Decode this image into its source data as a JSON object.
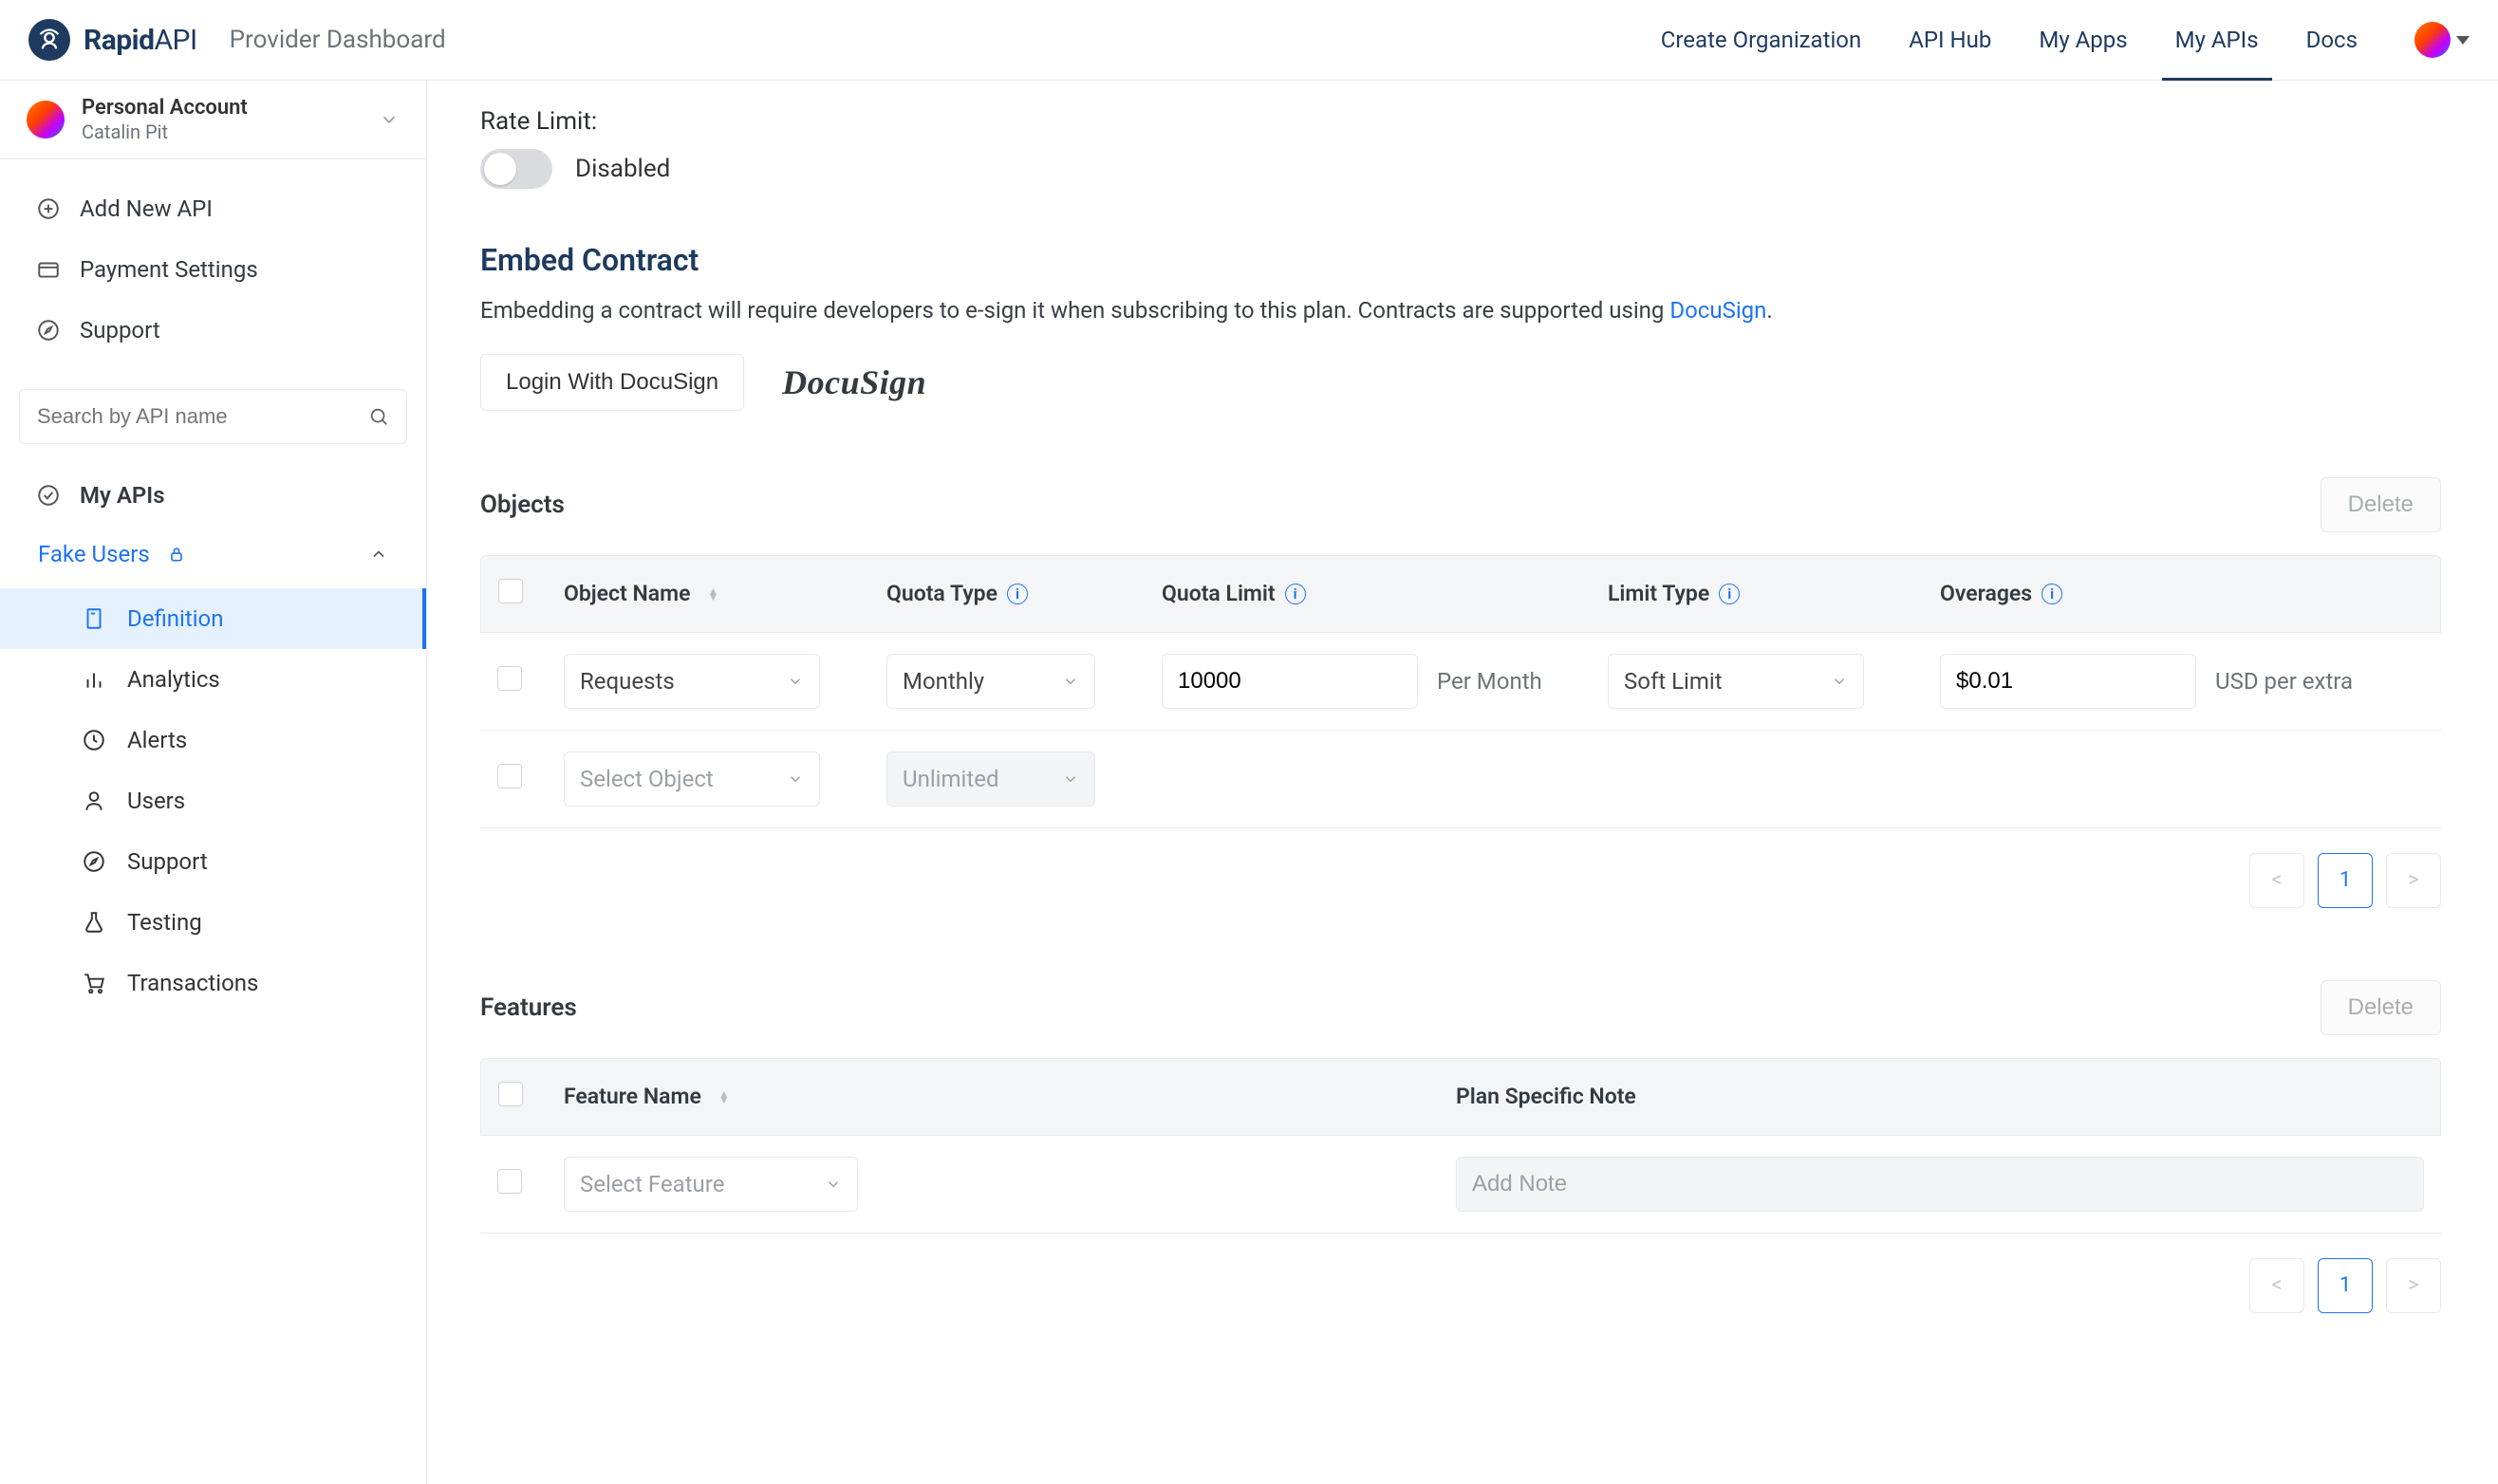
{
  "header": {
    "brand": "Rapid",
    "brand_suffix": "API",
    "subtitle": "Provider Dashboard",
    "nav": {
      "create_org": "Create Organization",
      "api_hub": "API Hub",
      "my_apps": "My Apps",
      "my_apis": "My APIs",
      "docs": "Docs"
    }
  },
  "sidebar": {
    "account": {
      "title": "Personal Account",
      "name": "Catalin Pit"
    },
    "add_api": "Add New API",
    "payment": "Payment Settings",
    "support": "Support",
    "search_placeholder": "Search by API name",
    "my_apis_label": "My APIs",
    "api_name": "Fake Users",
    "sub": {
      "definition": "Definition",
      "analytics": "Analytics",
      "alerts": "Alerts",
      "users": "Users",
      "support": "Support",
      "testing": "Testing",
      "transactions": "Transactions"
    }
  },
  "rate_limit": {
    "label": "Rate Limit:",
    "state": "Disabled"
  },
  "embed": {
    "title": "Embed Contract",
    "desc_pre": "Embedding a contract will require developers to e-sign it when subscribing to this plan. Contracts are supported using ",
    "link_text": "DocuSign",
    "desc_post": ".",
    "login_btn": "Login With DocuSign",
    "logo_text": "DocuSign"
  },
  "objects": {
    "title": "Objects",
    "delete_btn": "Delete",
    "cols": {
      "name": "Object Name",
      "quota_type": "Quota Type",
      "quota_limit": "Quota Limit",
      "limit_type": "Limit Type",
      "overages": "Overages"
    },
    "row1": {
      "name": "Requests",
      "quota_type": "Monthly",
      "quota_limit": "10000",
      "quota_unit": "Per Month",
      "limit_type": "Soft Limit",
      "overage": "$0.01",
      "overage_unit": "USD per extra"
    },
    "row2": {
      "name_placeholder": "Select Object",
      "quota_type_placeholder": "Unlimited"
    },
    "page": "1"
  },
  "features": {
    "title": "Features",
    "delete_btn": "Delete",
    "cols": {
      "name": "Feature Name",
      "note": "Plan Specific Note"
    },
    "row1": {
      "select_placeholder": "Select Feature",
      "note_placeholder": "Add Note"
    },
    "page": "1"
  }
}
